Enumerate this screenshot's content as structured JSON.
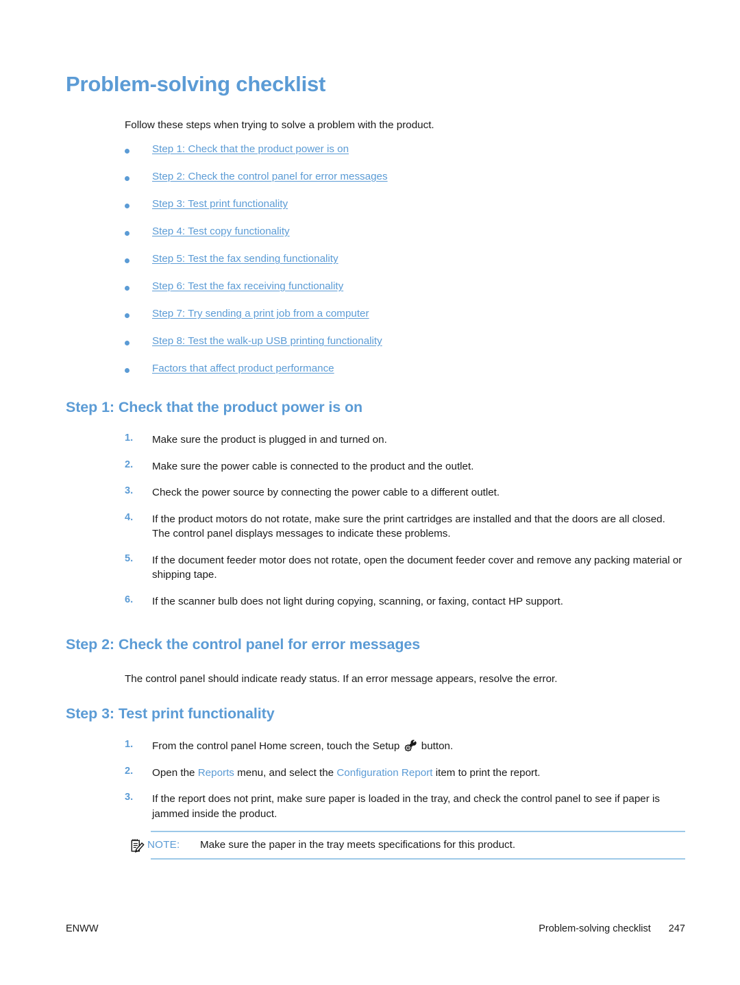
{
  "document": {
    "title": "Problem-solving checklist",
    "intro": "Follow these steps when trying to solve a problem with the product."
  },
  "checklist_links": [
    {
      "label": "Step 1: Check that the product power is on"
    },
    {
      "label": "Step 2: Check the control panel for error messages"
    },
    {
      "label": "Step 3: Test print functionality"
    },
    {
      "label": "Step 4: Test copy functionality"
    },
    {
      "label": "Step 5: Test the fax sending functionality"
    },
    {
      "label": "Step 6: Test the fax receiving functionality"
    },
    {
      "label": "Step 7: Try sending a print job from a computer"
    },
    {
      "label": "Step 8: Test the walk-up USB printing functionality"
    },
    {
      "label": "Factors that affect product performance"
    }
  ],
  "step1": {
    "heading": "Step 1: Check that the product power is on",
    "items": [
      {
        "num": "1.",
        "text": "Make sure the product is plugged in and turned on."
      },
      {
        "num": "2.",
        "text": "Make sure the power cable is connected to the product and the outlet."
      },
      {
        "num": "3.",
        "text": "Check the power source by connecting the power cable to a different outlet."
      },
      {
        "num": "4.",
        "text": "If the product motors do not rotate, make sure the print cartridges are installed and that the doors are all closed. The control panel displays messages to indicate these problems."
      },
      {
        "num": "5.",
        "text": "If the document feeder motor does not rotate, open the document feeder cover and remove any packing material or shipping tape."
      },
      {
        "num": "6.",
        "text": "If the scanner bulb does not light during copying, scanning, or faxing, contact HP support."
      }
    ]
  },
  "step2": {
    "heading": "Step 2: Check the control panel for error messages",
    "paragraph": "The control panel should indicate ready status. If an error message appears, resolve the error."
  },
  "step3": {
    "heading": "Step 3: Test print functionality",
    "item1": {
      "num": "1.",
      "before_icon": "From the control panel Home screen, touch the Setup ",
      "icon_name": "setup-wrench-gear-icon",
      "after_icon": " button."
    },
    "item2": {
      "num": "2.",
      "part1": "Open the ",
      "ui1": "Reports",
      "part2": " menu, and select the ",
      "ui2": "Configuration Report",
      "part3": " item to print the report."
    },
    "item3": {
      "num": "3.",
      "text": "If the report does not print, make sure paper is loaded in the tray, and check the control panel to see if paper is jammed inside the product."
    }
  },
  "note": {
    "icon_name": "notepad-pencil-icon",
    "label": "NOTE:",
    "text": "Make sure the paper in the tray meets specifications for this product."
  },
  "footer": {
    "left": "ENWW",
    "chapter": "Problem-solving checklist",
    "page_number": "247"
  },
  "colors": {
    "accent_blue": "#5B9BD5",
    "rule_blue": "#9CC8E8",
    "body_text": "#1a1a1a"
  }
}
